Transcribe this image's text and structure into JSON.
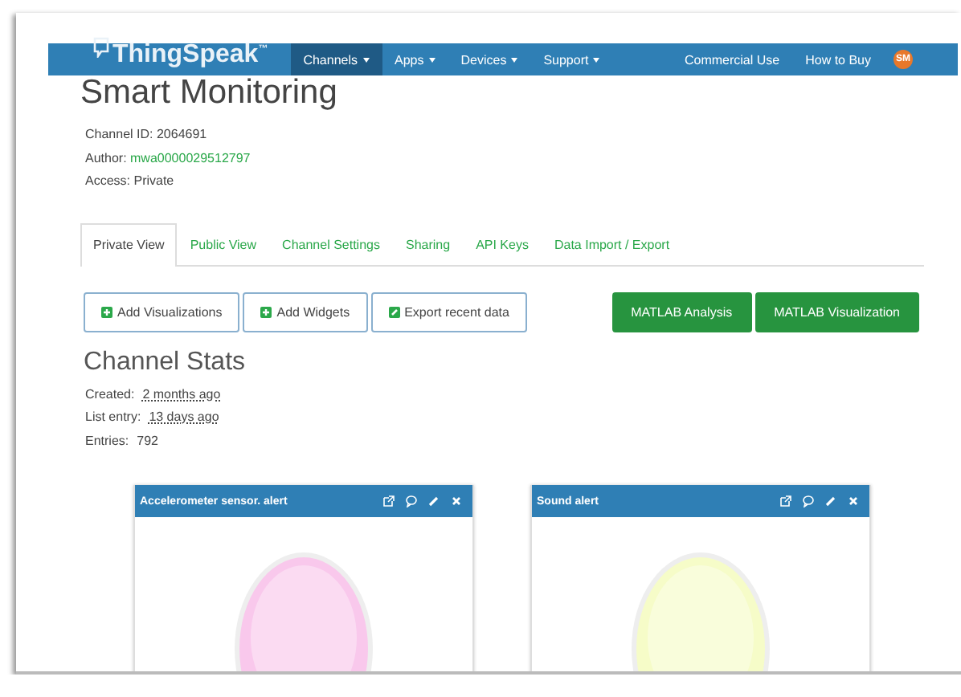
{
  "navbar": {
    "logo": "ThingSpeak",
    "logo_mark": "™",
    "menus": [
      {
        "label": "Channels",
        "selected": true
      },
      {
        "label": "Apps",
        "selected": false
      },
      {
        "label": "Devices",
        "selected": false
      },
      {
        "label": "Support",
        "selected": false
      }
    ],
    "links": [
      "Commercial Use",
      "How to Buy"
    ],
    "avatar": "SM"
  },
  "channel": {
    "title": "Smart Monitoring",
    "info": [
      {
        "label": "Channel ID: ",
        "value": "2064691",
        "kind": "text"
      },
      {
        "label": "Author: ",
        "value": "mwa0000029512797",
        "kind": "link"
      },
      {
        "label": "Access: ",
        "value": "Private",
        "kind": "text"
      }
    ]
  },
  "tabs": [
    {
      "label": "Private View",
      "selected": true
    },
    {
      "label": "Public View",
      "selected": false
    },
    {
      "label": "Channel Settings",
      "selected": false
    },
    {
      "label": "Sharing",
      "selected": false
    },
    {
      "label": "API Keys",
      "selected": false
    },
    {
      "label": "Data Import / Export",
      "selected": false
    }
  ],
  "actions": [
    {
      "label": "Add Visualizations",
      "kind": "add"
    },
    {
      "label": "Add Widgets",
      "kind": "add"
    },
    {
      "label": "Export recent data",
      "kind": "export"
    }
  ],
  "matlab_buttons": [
    "MATLAB Analysis",
    "MATLAB Visualization"
  ],
  "stats": {
    "title": "Channel Stats",
    "items": [
      {
        "label": "Created:",
        "value": "2 months ago",
        "kind": "time"
      },
      {
        "label": "List entry:",
        "value": "13 days ago",
        "kind": "time"
      },
      {
        "label": "Entries:",
        "value": "792",
        "kind": "count"
      }
    ]
  },
  "widgets": [
    {
      "title": "Accelerometer sensor. alert",
      "color": "#f9c8ec"
    },
    {
      "title": "Sound alert",
      "color": "#f6fcc8"
    }
  ]
}
